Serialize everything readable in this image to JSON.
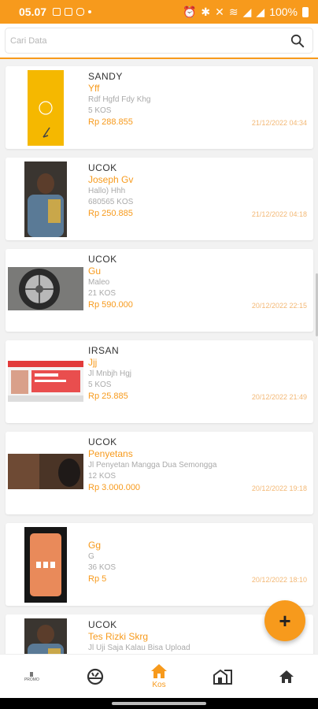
{
  "status_bar": {
    "time": "05.07",
    "battery": "100%"
  },
  "search": {
    "placeholder": "Cari Data"
  },
  "records": [
    {
      "user": "SANDY",
      "name": "Yff",
      "address": "Rdf Hgfd Fdy Khg",
      "qty": "5 KOS",
      "price": "Rp 288.855",
      "date": "21/12/2022 04:34",
      "thumb": "yellow-packaging-photo"
    },
    {
      "user": "UCOK",
      "name": "Joseph Gv",
      "address": "Hallo) Hhh",
      "qty": "680565 KOS",
      "price": "Rp 250.885",
      "date": "21/12/2022 04:18",
      "thumb": "person-photo"
    },
    {
      "user": "UCOK",
      "name": "Gu",
      "address": "Maleo",
      "qty": "21 KOS",
      "price": "Rp 590.000",
      "date": "20/12/2022 22:15",
      "thumb": "car-wheel-photo"
    },
    {
      "user": "IRSAN",
      "name": "Jjj",
      "address": "Jl Mnbjh Hgj",
      "qty": "5 KOS",
      "price": "Rp 25.885",
      "date": "20/12/2022 21:49",
      "thumb": "promo-banner-photo"
    },
    {
      "user": "UCOK",
      "name": "Penyetans",
      "address": "Jl Penyetan Mangga Dua Semongga",
      "qty": "12 KOS",
      "price": "Rp 3.000.000",
      "date": "20/12/2022 19:18",
      "thumb": "dark-car-photo"
    },
    {
      "user": "",
      "name": "Gg",
      "address": "G",
      "qty": "36 KOS",
      "price": "Rp 5",
      "date": "20/12/2022 18:10",
      "thumb": "phone-screen-photo"
    },
    {
      "user": "UCOK",
      "name": "Tes Rizki Skrg",
      "address": "Jl Uji Saja Kalau Bisa Upload",
      "qty": "",
      "price": "",
      "date": "",
      "thumb": "person-photo"
    }
  ],
  "fab": {
    "label": "+"
  },
  "nav": {
    "tiny_label": "PROMO",
    "active_label": "Kos",
    "items": [
      "promo-icon",
      "dashboard-icon",
      "home-icon",
      "building-icon",
      "house-icon"
    ]
  },
  "colors": {
    "accent": "#f79a1c",
    "background": "#f2f2f2"
  }
}
